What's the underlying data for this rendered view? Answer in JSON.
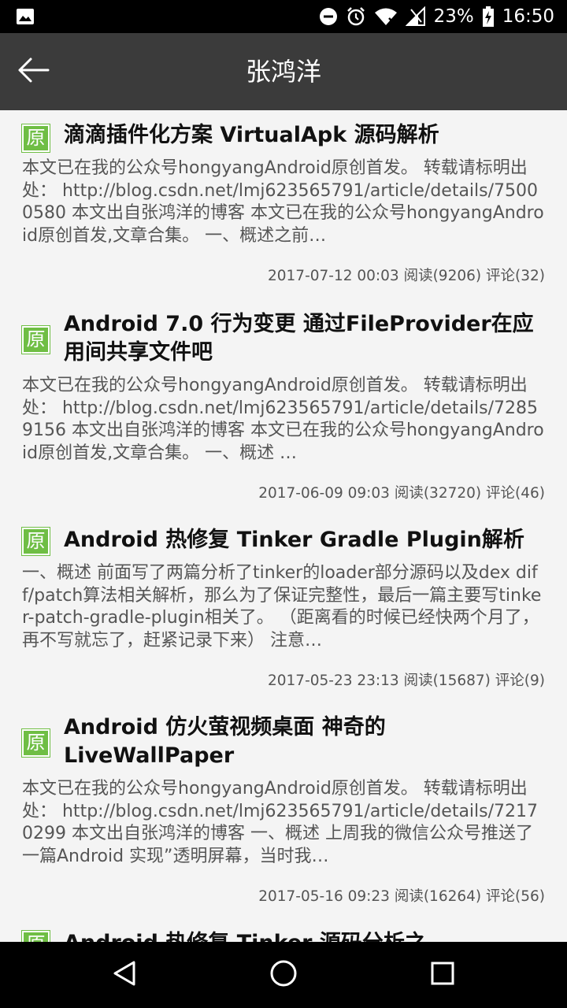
{
  "status_bar": {
    "battery": "23%",
    "time": "16:50",
    "icons": [
      "image-icon",
      "do-not-disturb-icon",
      "alarm-icon",
      "wifi-icon",
      "signal-icon",
      "battery-charging-icon"
    ]
  },
  "app_bar": {
    "title": "张鸿洋",
    "back_icon": "back-arrow-icon"
  },
  "colors": {
    "status_bar": "#000000",
    "app_bar": "#3b3b3b",
    "badge": "#6fbe44",
    "background": "#f4f4f4"
  },
  "articles": [
    {
      "badge": "原",
      "title": "滴滴插件化方案 VirtualApk 源码解析",
      "summary": "本文已在我的公众号hongyangAndroid原创首发。 转载请标明出处： http://blog.csdn.net/lmj623565791/article/details/75000580 本文出自张鸿洋的博客 本文已在我的公众号hongyangAndroid原创首发,文章合集。 一、概述之前…",
      "date": "2017-07-12 00:03",
      "reads": "阅读(9206)",
      "comments": "评论(32)"
    },
    {
      "badge": "原",
      "title": "Android 7.0 行为变更 通过FileProvider在应用间共享文件吧",
      "summary": "本文已在我的公众号hongyangAndroid原创首发。 转载请标明出处： http://blog.csdn.net/lmj623565791/article/details/72859156 本文出自张鸿洋的博客 本文已在我的公众号hongyangAndroid原创首发,文章合集。 一、概述 …",
      "date": "2017-06-09 09:03",
      "reads": "阅读(32720)",
      "comments": "评论(46)"
    },
    {
      "badge": "原",
      "title": "Android 热修复 Tinker Gradle Plugin解析",
      "summary": "一、概述 前面写了两篇分析了tinker的loader部分源码以及dex diff/patch算法相关解析，那么为了保证完整性，最后一篇主要写tinker-patch-gradle-plugin相关了。 （距离看的时候已经快两个月了，再不写就忘了，赶紧记录下来） 注意…",
      "date": "2017-05-23 23:13",
      "reads": "阅读(15687)",
      "comments": "评论(9)"
    },
    {
      "badge": "原",
      "title": "Android 仿火萤视频桌面 神奇的LiveWallPaper",
      "summary": "本文已在我的公众号hongyangAndroid原创首发。 转载请标明出处： http://blog.csdn.net/lmj623565791/article/details/72170299 本文出自张鸿洋的博客 一、概述 上周我的微信公众号推送了一篇Android 实现”透明屏幕，当时我…",
      "date": "2017-05-16 09:23",
      "reads": "阅读(16264)",
      "comments": "评论(56)"
    },
    {
      "badge": "原",
      "title": "Android 热修复 Tinker 源码分析之"
    }
  ],
  "nav_bar": {
    "buttons": [
      "back-triangle-icon",
      "home-circle-icon",
      "recents-square-icon"
    ]
  }
}
